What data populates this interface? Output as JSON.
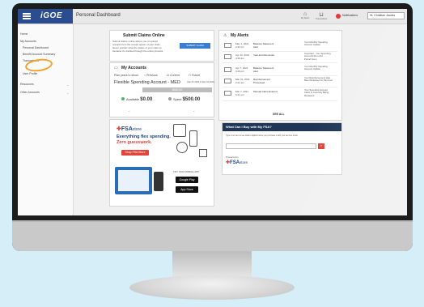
{
  "topbar": {
    "logo": "iGOE",
    "page_title": "Personal Dashboard",
    "icon_labels": [
      "My Alerts",
      "Transactions"
    ],
    "notifications_label": "Notifications",
    "user_label": "Hi, Christian Jacobs"
  },
  "sidebar": {
    "items": [
      "Home",
      "My Accounts",
      "Personal Dashboard",
      "Benefit Account Summary",
      "Transactions",
      "User Profile",
      "Resources",
      "Other Accounts"
    ]
  },
  "claims_card": {
    "title": "Submit Claims Online",
    "text": [
      "Submit claims online above you or upload",
      "receipts from the receipt option of your claim.",
      "Never wonder what the status of your claim is",
      "because it's tracked through the entire process."
    ],
    "button_label": "SUBMIT CLAIM"
  },
  "accounts_card": {
    "title": "My Accounts",
    "plan_year_label": "Plan years to show:",
    "filters": [
      "Previous",
      "Current",
      "Future"
    ],
    "account_name": "Flexible Spending Account - MED",
    "account_dates": "(Jan 01 2020 to Dec 31 2021)",
    "balance": "$550.00",
    "available_label": "Available",
    "available_value": "$0.00",
    "spent_label": "Spent",
    "spent_value": "$500.00"
  },
  "alerts_card": {
    "title": "My Alerts",
    "rows": [
      {
        "date": "May 1, 2021\n2:32 pm",
        "type": "Balance Statement\nAlert",
        "desc": "Your Monthly Spending\nAccount Update"
      },
      {
        "date": "Apr 14, 2021\n4:36 am",
        "type": "Year-End Reminder",
        "desc": "Important - Your Spending\nAccounts Run-Out\nPeriod Soon"
      },
      {
        "date": "Apr 7, 2021\n3:29 pm",
        "type": "Balance Statement\nAlert",
        "desc": "Your Monthly Spending\nAccount Update"
      },
      {
        "date": "Mar 31, 2021\n2:22 am",
        "type": "Reimbursement\nProcessed",
        "desc": "Your Reimbursement Has\nBeen Released for Payment"
      },
      {
        "date": "Mar 7, 2021\n6:21 pm",
        "type": "Manual Claim Entered",
        "desc": "Your Spending Account\nClaim Is Currently Being\nReviewed"
      }
    ],
    "see_all": "SEE ALL"
  },
  "fsa_promo": {
    "brand": "FSA",
    "brand_suffix": "store",
    "headline_1": "Everything flex spending.",
    "headline_2": "Zero guesswork.",
    "shop_button": "Shop FSA Store",
    "app_label": "TRY OUR MOBILE APP",
    "google_play": "Google Play",
    "app_store": "App Store"
  },
  "buy_card": {
    "title": "What Can I Buy with My FSA?",
    "instructions": "Type in an item to see what's eligible before you purchase it with your tax-free funds.",
    "powered_by": "Powered by",
    "brand": "FSA",
    "brand_suffix": "store"
  },
  "colors": {
    "brand_blue": "#2b4c8e",
    "accent_red": "#e0443a",
    "highlight_orange": "#f3a12a",
    "navy": "#1f3658"
  }
}
